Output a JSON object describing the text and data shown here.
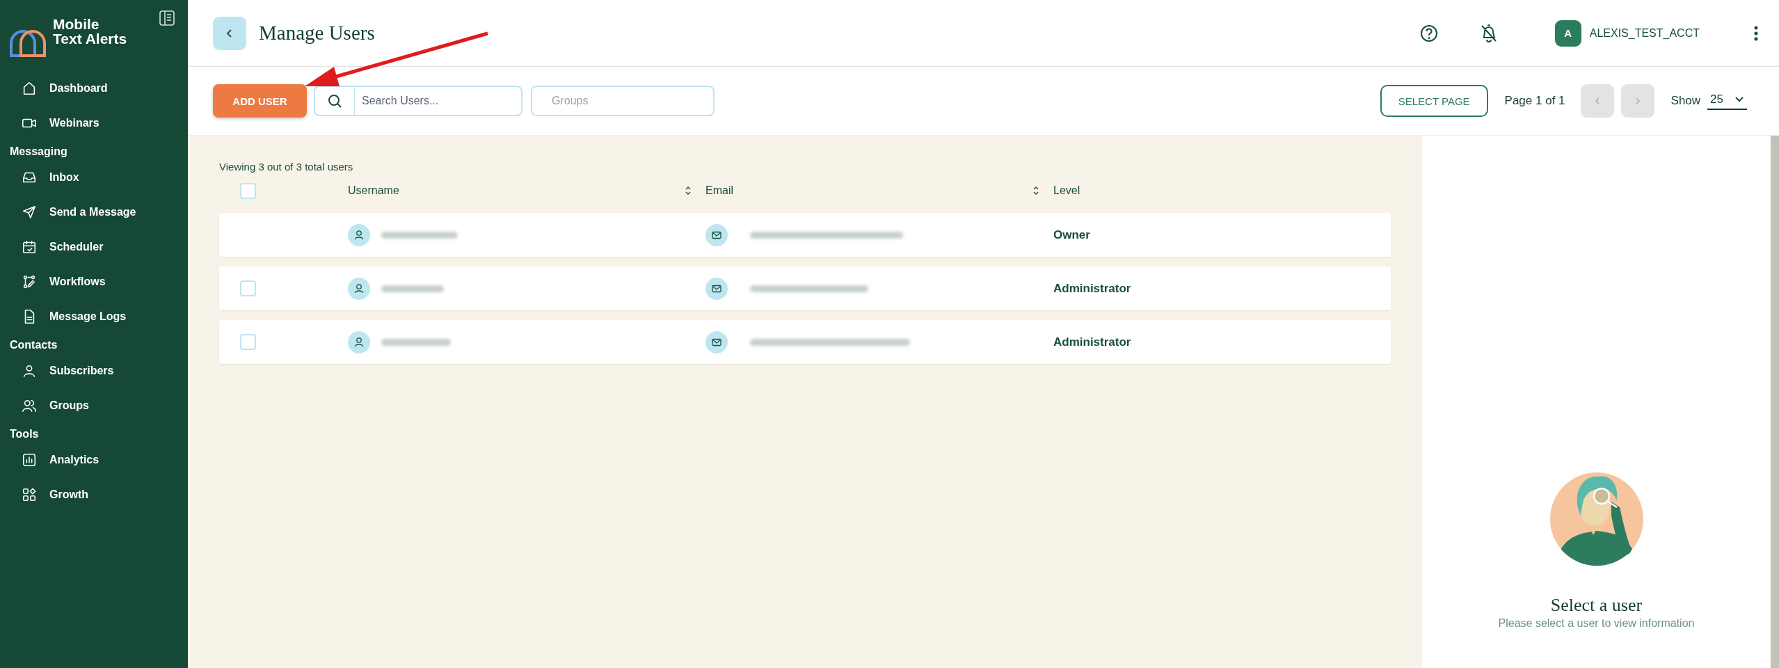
{
  "sidebar": {
    "brand": "Mobile Text Alerts",
    "groups": [
      {
        "items": [
          {
            "label": "Dashboard"
          },
          {
            "label": "Webinars"
          }
        ]
      },
      {
        "heading": "Messaging",
        "items": [
          {
            "label": "Inbox"
          },
          {
            "label": "Send a Message"
          },
          {
            "label": "Scheduler"
          },
          {
            "label": "Workflows"
          },
          {
            "label": "Message Logs"
          }
        ]
      },
      {
        "heading": "Contacts",
        "items": [
          {
            "label": "Subscribers"
          },
          {
            "label": "Groups"
          }
        ]
      },
      {
        "heading": "Tools",
        "items": [
          {
            "label": "Analytics"
          },
          {
            "label": "Growth"
          }
        ]
      }
    ]
  },
  "header": {
    "title": "Manage Users",
    "account": {
      "initial": "A",
      "name": "ALEXIS_TEST_ACCT"
    }
  },
  "toolbar": {
    "add_button": "ADD USER",
    "search": {
      "placeholder": "Search Users..."
    },
    "groups_filter": {
      "placeholder": "Groups"
    },
    "select_page_button": "SELECT PAGE",
    "page_info": "Page 1 of 1",
    "show_label": "Show",
    "show_value": "25"
  },
  "table": {
    "summary": "Viewing 3 out of 3 total users",
    "header_checked": false,
    "columns": [
      "Username",
      "Email",
      "Level"
    ],
    "rows": [
      {
        "has_checkbox": false,
        "access_level": "Owner"
      },
      {
        "has_checkbox": true,
        "checked": false,
        "access_level": "Administrator"
      },
      {
        "has_checkbox": true,
        "checked": false,
        "access_level": "Administrator"
      }
    ]
  },
  "detail": {
    "title": "Select a user",
    "subtitle": "Please select a user to view information"
  }
}
